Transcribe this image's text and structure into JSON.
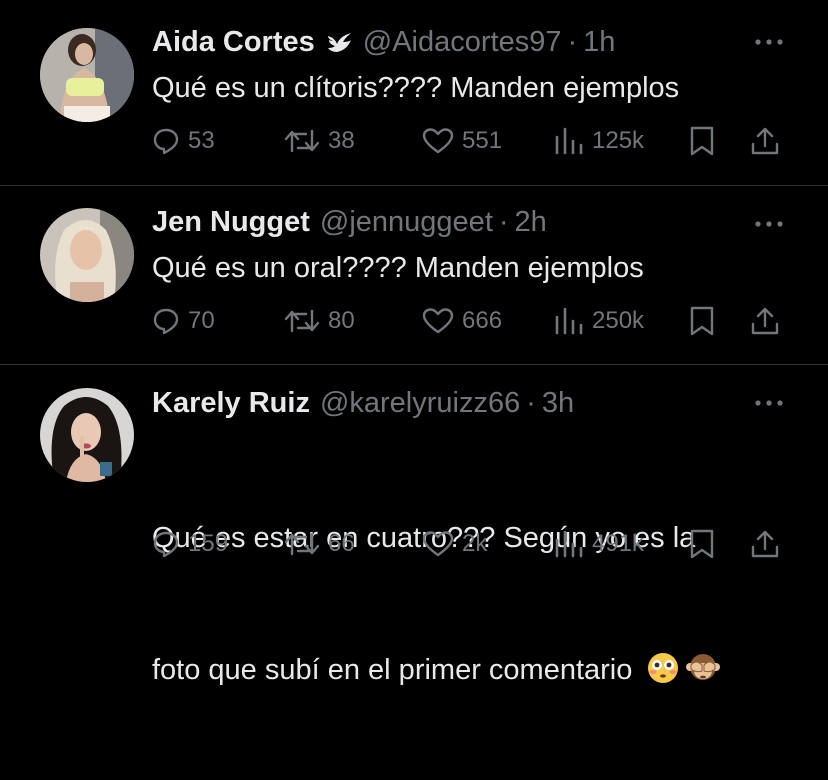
{
  "colors": {
    "background": "#000000",
    "text": "#e7e9ea",
    "muted": "#71767b",
    "divider": "#2f3336"
  },
  "tweets": [
    {
      "name": "Aida Cortes",
      "verified": true,
      "handle": "@Aidacortes97",
      "separator": "·",
      "time": "1h",
      "text": "Qué es un clítoris???? Manden ejemplos",
      "replies": "53",
      "retweets": "38",
      "likes": "551",
      "views": "125k"
    },
    {
      "name": "Jen Nugget",
      "verified": false,
      "handle": "@jennuggeet",
      "separator": "·",
      "time": "2h",
      "text": "Qué es un oral???? Manden ejemplos",
      "replies": "70",
      "retweets": "80",
      "likes": "666",
      "views": "250k"
    },
    {
      "name": "Karely Ruiz",
      "verified": false,
      "handle": "@karelyruizz66",
      "separator": "·",
      "time": "3h",
      "text_line1": "Qué es estar en cuatro??? Según yo es la",
      "text_line2": "foto que subí en el primer comentario",
      "emojis": [
        "flushed-face",
        "see-no-evil-monkey"
      ],
      "replies": "159",
      "retweets": "66",
      "likes": "2k",
      "views": "491k"
    }
  ],
  "icons": [
    "more-icon",
    "reply-icon",
    "retweet-icon",
    "like-icon",
    "views-icon",
    "bookmark-icon",
    "share-icon",
    "verified-icon"
  ]
}
